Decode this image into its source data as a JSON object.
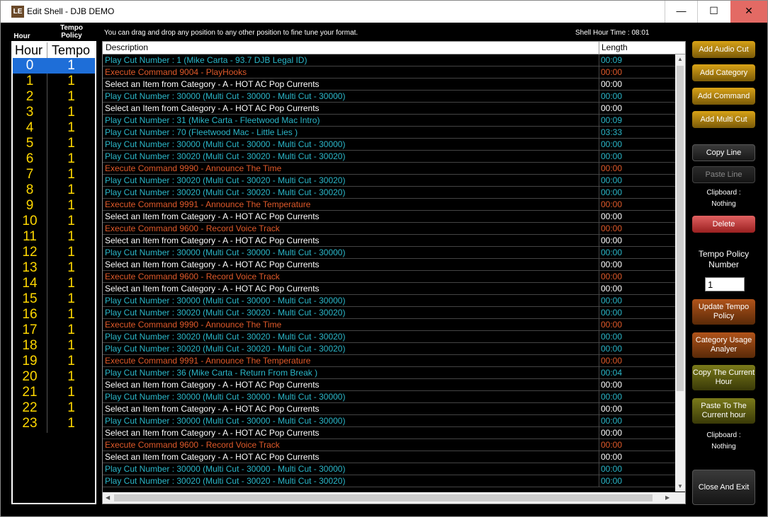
{
  "window": {
    "title": "Edit Shell - DJB DEMO",
    "icon_text": "LE",
    "min": "—",
    "max": "☐",
    "close": "✕"
  },
  "hours_header": {
    "hour_small": "Hour",
    "tempo_small": "Tempo Policy",
    "col1": "Hour",
    "col2": "Tempo"
  },
  "hours": [
    {
      "h": "0",
      "t": "1"
    },
    {
      "h": "1",
      "t": "1"
    },
    {
      "h": "2",
      "t": "1"
    },
    {
      "h": "3",
      "t": "1"
    },
    {
      "h": "4",
      "t": "1"
    },
    {
      "h": "5",
      "t": "1"
    },
    {
      "h": "6",
      "t": "1"
    },
    {
      "h": "7",
      "t": "1"
    },
    {
      "h": "8",
      "t": "1"
    },
    {
      "h": "9",
      "t": "1"
    },
    {
      "h": "10",
      "t": "1"
    },
    {
      "h": "11",
      "t": "1"
    },
    {
      "h": "12",
      "t": "1"
    },
    {
      "h": "13",
      "t": "1"
    },
    {
      "h": "14",
      "t": "1"
    },
    {
      "h": "15",
      "t": "1"
    },
    {
      "h": "16",
      "t": "1"
    },
    {
      "h": "17",
      "t": "1"
    },
    {
      "h": "18",
      "t": "1"
    },
    {
      "h": "19",
      "t": "1"
    },
    {
      "h": "20",
      "t": "1"
    },
    {
      "h": "21",
      "t": "1"
    },
    {
      "h": "22",
      "t": "1"
    },
    {
      "h": "23",
      "t": "1"
    }
  ],
  "info": {
    "hint": "You can drag and drop any position to any other position to fine tune your format.",
    "shell_time": "Shell Hour Time : 08:01"
  },
  "grid": {
    "col_desc": "Description",
    "col_len": "Length",
    "rows": [
      {
        "d": "Play Cut Number : 1 (Mike Carta - 93.7 DJB Legal ID)",
        "l": "00:09",
        "k": "cut"
      },
      {
        "d": "Execute Command 9004 - PlayHooks",
        "l": "00:00",
        "k": "cmd"
      },
      {
        "d": "Select an Item from Category - A - HOT AC Pop Currents",
        "l": "00:00",
        "k": "cat"
      },
      {
        "d": "Play Cut Number : 30000 (Multi Cut - 30000 - Multi Cut - 30000)",
        "l": "00:00",
        "k": "cut"
      },
      {
        "d": "Select an Item from Category - A - HOT AC Pop Currents",
        "l": "00:00",
        "k": "cat"
      },
      {
        "d": "Play Cut Number : 31 (Mike Carta - Fleetwood Mac Intro)",
        "l": "00:09",
        "k": "cut"
      },
      {
        "d": "Play Cut Number : 70 (Fleetwood Mac - Little Lies )",
        "l": "03:33",
        "k": "cut"
      },
      {
        "d": "Play Cut Number : 30000 (Multi Cut - 30000 - Multi Cut - 30000)",
        "l": "00:00",
        "k": "cut"
      },
      {
        "d": "Play Cut Number : 30020 (Multi Cut - 30020 - Multi Cut - 30020)",
        "l": "00:00",
        "k": "cut"
      },
      {
        "d": "Execute Command 9990 - Announce The Time",
        "l": "00:00",
        "k": "cmd"
      },
      {
        "d": "Play Cut Number : 30020 (Multi Cut - 30020 - Multi Cut - 30020)",
        "l": "00:00",
        "k": "cut"
      },
      {
        "d": "Play Cut Number : 30020 (Multi Cut - 30020 - Multi Cut - 30020)",
        "l": "00:00",
        "k": "cut"
      },
      {
        "d": "Execute Command 9991 - Announce The Temperature",
        "l": "00:00",
        "k": "cmd"
      },
      {
        "d": "Select an Item from Category - A - HOT AC Pop Currents",
        "l": "00:00",
        "k": "cat"
      },
      {
        "d": "Execute Command 9600 - Record Voice Track",
        "l": "00:00",
        "k": "cmd"
      },
      {
        "d": "Select an Item from Category - A - HOT AC Pop Currents",
        "l": "00:00",
        "k": "cat"
      },
      {
        "d": "Play Cut Number : 30000 (Multi Cut - 30000 - Multi Cut - 30000)",
        "l": "00:00",
        "k": "cut"
      },
      {
        "d": "Select an Item from Category - A - HOT AC Pop Currents",
        "l": "00:00",
        "k": "cat"
      },
      {
        "d": "Execute Command 9600 - Record Voice Track",
        "l": "00:00",
        "k": "cmd"
      },
      {
        "d": "Select an Item from Category - A - HOT AC Pop Currents",
        "l": "00:00",
        "k": "cat"
      },
      {
        "d": "Play Cut Number : 30000 (Multi Cut - 30000 - Multi Cut - 30000)",
        "l": "00:00",
        "k": "cut"
      },
      {
        "d": "Play Cut Number : 30020 (Multi Cut - 30020 - Multi Cut - 30020)",
        "l": "00:00",
        "k": "cut"
      },
      {
        "d": "Execute Command 9990 - Announce The Time",
        "l": "00:00",
        "k": "cmd"
      },
      {
        "d": "Play Cut Number : 30020 (Multi Cut - 30020 - Multi Cut - 30020)",
        "l": "00:00",
        "k": "cut"
      },
      {
        "d": "Play Cut Number : 30020 (Multi Cut - 30020 - Multi Cut - 30020)",
        "l": "00:00",
        "k": "cut"
      },
      {
        "d": "Execute Command 9991 - Announce The Temperature",
        "l": "00:00",
        "k": "cmd"
      },
      {
        "d": "Play Cut Number : 36 (Mike Carta - Return From Break )",
        "l": "00:04",
        "k": "cut"
      },
      {
        "d": "Select an Item from Category - A - HOT AC Pop Currents",
        "l": "00:00",
        "k": "cat"
      },
      {
        "d": "Play Cut Number : 30000 (Multi Cut - 30000 - Multi Cut - 30000)",
        "l": "00:00",
        "k": "cut"
      },
      {
        "d": "Select an Item from Category - A - HOT AC Pop Currents",
        "l": "00:00",
        "k": "cat"
      },
      {
        "d": "Play Cut Number : 30000 (Multi Cut - 30000 - Multi Cut - 30000)",
        "l": "00:00",
        "k": "cut"
      },
      {
        "d": "Select an Item from Category - A - HOT AC Pop Currents",
        "l": "00:00",
        "k": "cat"
      },
      {
        "d": "Execute Command 9600 - Record Voice Track",
        "l": "00:00",
        "k": "cmd"
      },
      {
        "d": "Select an Item from Category - A - HOT AC Pop Currents",
        "l": "00:00",
        "k": "cat"
      },
      {
        "d": "Play Cut Number : 30000 (Multi Cut - 30000 - Multi Cut - 30000)",
        "l": "00:00",
        "k": "cut"
      },
      {
        "d": "Play Cut Number : 30020 (Multi Cut - 30020 - Multi Cut - 30020)",
        "l": "00:00",
        "k": "cut"
      }
    ]
  },
  "buttons": {
    "add_audio_cut": "Add Audio Cut",
    "add_category": "Add Category",
    "add_command": "Add Command",
    "add_multi_cut": "Add Multi Cut",
    "copy_line": "Copy Line",
    "paste_line": "Paste Line",
    "clipboard_label": "Clipboard :",
    "clipboard_value": "Nothing",
    "delete": "Delete",
    "tempo_policy_label": "Tempo Policy Number",
    "tempo_policy_value": "1",
    "update_tempo": "Update Tempo Policy",
    "category_usage": "Category Usage Analyer",
    "copy_hour": "Copy The Current Hour",
    "paste_hour": "Paste To The Current hour",
    "clipboard2_label": "Clipboard :",
    "clipboard2_value": "Nothing",
    "close_exit": "Close And Exit"
  },
  "colors": {
    "cut": "#2bb7c9",
    "command": "#e05a2a",
    "category": "#ffffff",
    "hour_text": "#ffd700",
    "selection": "#1e6ed8"
  }
}
